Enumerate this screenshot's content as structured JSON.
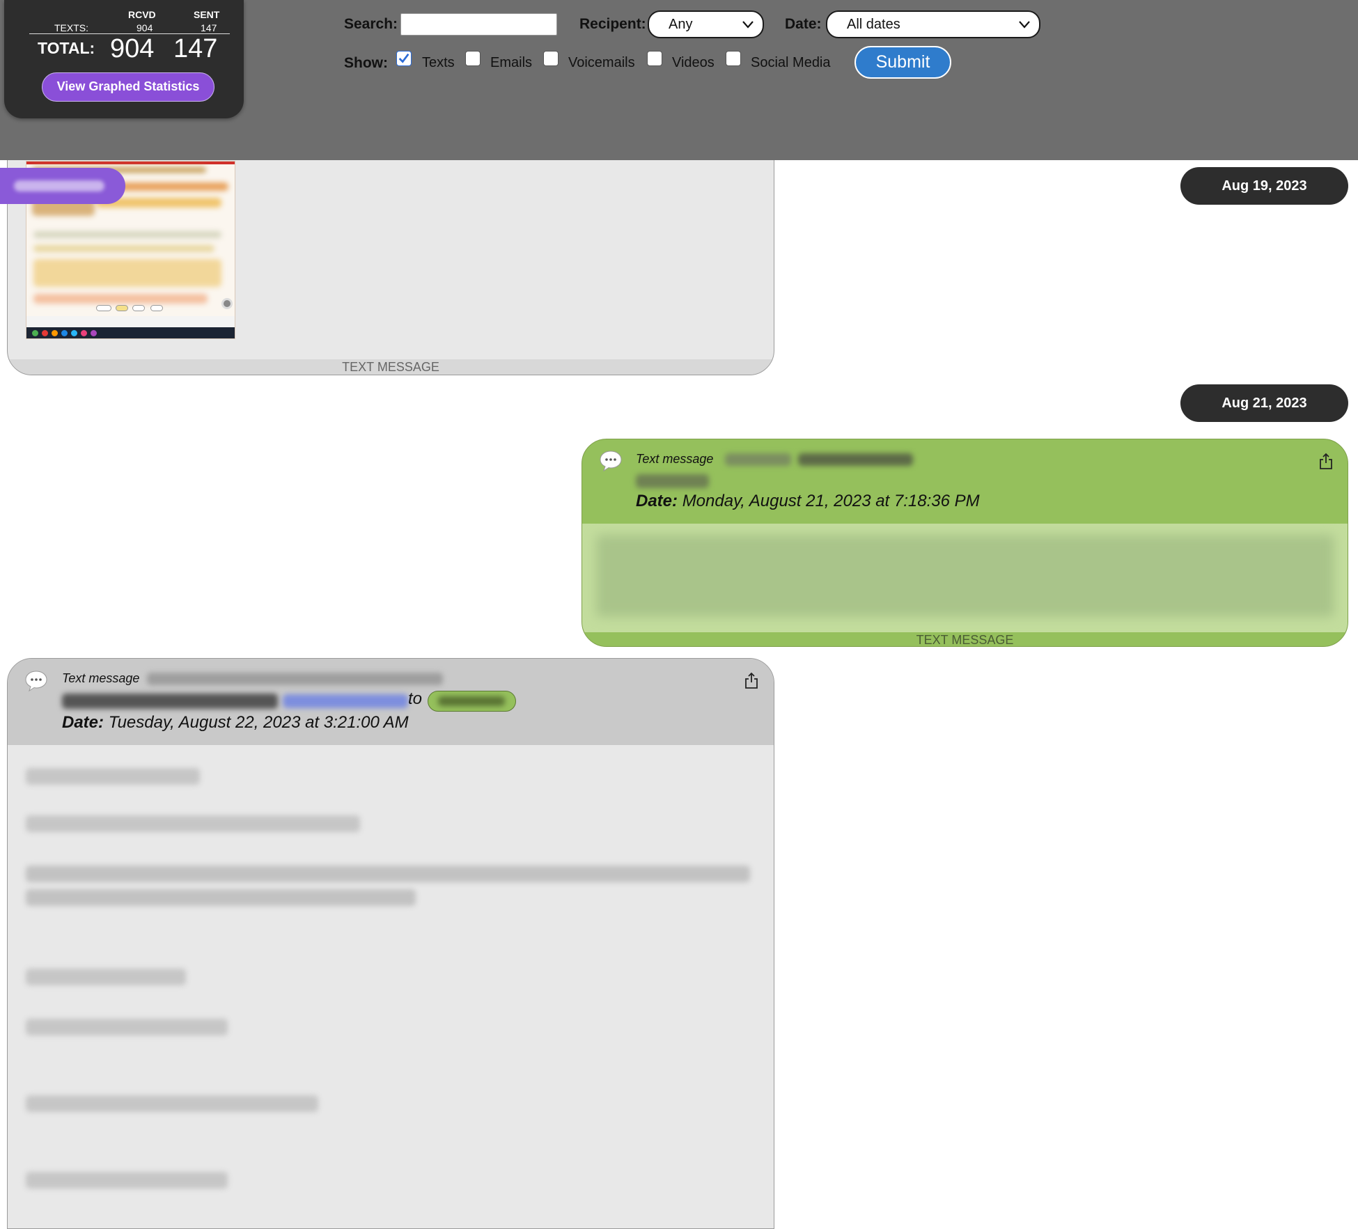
{
  "stats": {
    "col_rcvd": "RCVD",
    "col_sent": "SENT",
    "texts_label": "TEXTS:",
    "texts_rcvd": "904",
    "texts_sent": "147",
    "total_label": "TOTAL:",
    "total_rcvd": "904",
    "total_sent": "147",
    "graph_button": "View Graphed Statistics"
  },
  "filters": {
    "search_label": "Search:",
    "search_value": "",
    "recipient_label": "Recipent:",
    "recipient_value": "Any",
    "date_label": "Date:",
    "date_value": "All dates",
    "show_label": "Show:",
    "options": [
      {
        "label": "Texts",
        "checked": true
      },
      {
        "label": "Emails",
        "checked": false
      },
      {
        "label": "Voicemails",
        "checked": false
      },
      {
        "label": "Videos",
        "checked": false
      },
      {
        "label": "Social Media",
        "checked": false
      }
    ],
    "submit_label": "Submit"
  },
  "feed": {
    "date_1": "Aug 19, 2023",
    "date_2": "Aug 21, 2023",
    "card_1_type": "TEXT MESSAGE",
    "card_2": {
      "title": "Text message",
      "date_label": "Date:",
      "date_value": "Monday, August 21, 2023 at 7:18:36 PM",
      "type": "TEXT MESSAGE"
    },
    "card_3": {
      "title": "Text message",
      "to_word": "to",
      "date_label": "Date:",
      "date_value": "Tuesday, August 22, 2023 at 3:21:00 AM"
    }
  },
  "colors": {
    "header_bg": "#6e6e6e",
    "panel_bg": "#2d2d2d",
    "accent_purple": "#8a4fd8",
    "submit_blue": "#2f7ccc",
    "sent_green": "#95c05c",
    "sent_green_light": "#c3dd9d",
    "rcvd_gray": "#e8e8e8"
  },
  "icons": [
    "chevron-down-icon",
    "checkbox-icon",
    "chat-bubble-icon",
    "share-icon"
  ]
}
